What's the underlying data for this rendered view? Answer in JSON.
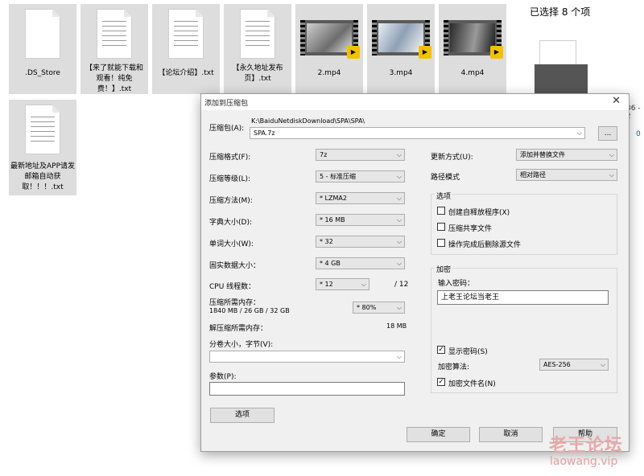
{
  "explorer": {
    "files": [
      {
        "name": ".DS_Store",
        "kind": "doc"
      },
      {
        "name": "【来了就能下载和观看！纯免费！】.txt",
        "kind": "doc"
      },
      {
        "name": "【论坛介绍】.txt",
        "kind": "doc"
      },
      {
        "name": "【永久地址发布页】.txt",
        "kind": "doc"
      },
      {
        "name": "2.mp4",
        "kind": "video"
      },
      {
        "name": "3.mp4",
        "kind": "video"
      },
      {
        "name": "4.mp4",
        "kind": "video"
      },
      {
        "name": "最新地址及APP请发邮箱自动获取！！！.txt",
        "kind": "doc"
      }
    ],
    "selection_text": "已选择 8 个项",
    "side_fragment_1": "36 - 2",
    "side_fragment_2": "0",
    "player_badge": "Player"
  },
  "dialog": {
    "title": "添加到压缩包",
    "close_glyph": "✕",
    "archive_label": "压缩包(A):",
    "archive_path": "K:\\BaiduNetdiskDownload\\SPA\\SPA\\",
    "archive_name": "SPA.7z",
    "browse_label": "...",
    "format_label": "压缩格式(F):",
    "format_value": "7z",
    "level_label": "压缩等级(L):",
    "level_value": "5 - 标准压缩",
    "method_label": "压缩方法(M):",
    "method_value": "* LZMA2",
    "dict_label": "字典大小(D):",
    "dict_value": "* 16 MB",
    "word_label": "单词大小(W):",
    "word_value": "* 32",
    "solid_label": "固实数据大小：",
    "solid_value": "* 4 GB",
    "cpu_label": "CPU 线程数：",
    "cpu_value": "* 12",
    "cpu_max": "/ 12",
    "mem_comp_label": "压缩所需内存：",
    "mem_comp_value": "1840 MB / 26 GB / 32 GB",
    "mem_comp_percent": "* 80%",
    "mem_decomp_label": "解压缩所需内存：",
    "mem_decomp_value": "18 MB",
    "split_label": "分卷大小，字节(V):",
    "split_value": "",
    "params_label": "参数(P):",
    "params_value": "",
    "options_button": "选项",
    "update_label": "更新方式(U):",
    "update_value": "添加并替换文件",
    "path_label": "路径模式",
    "path_value": "相对路径",
    "options_group": {
      "title": "选项",
      "sfx": "创建自释放程序(X)",
      "shared": "压缩共享文件",
      "delete": "操作完成后删除源文件"
    },
    "encrypt_group": {
      "title": "加密",
      "password_label": "输入密码：",
      "password_value": "上老王论坛当老王",
      "show_password": "显示密码(S)",
      "method_label": "加密算法:",
      "method_value": "AES-256",
      "encrypt_names": "加密文件名(N)"
    },
    "ok_button": "确定",
    "cancel_button": "取消",
    "help_button": "帮助"
  },
  "watermark": {
    "line1": "老王论坛",
    "line2": "laowang.vip"
  },
  "colors": {
    "tile_bg": "#dddddd",
    "dialog_bg": "#f0f0f0",
    "badge": "#f2c100"
  }
}
